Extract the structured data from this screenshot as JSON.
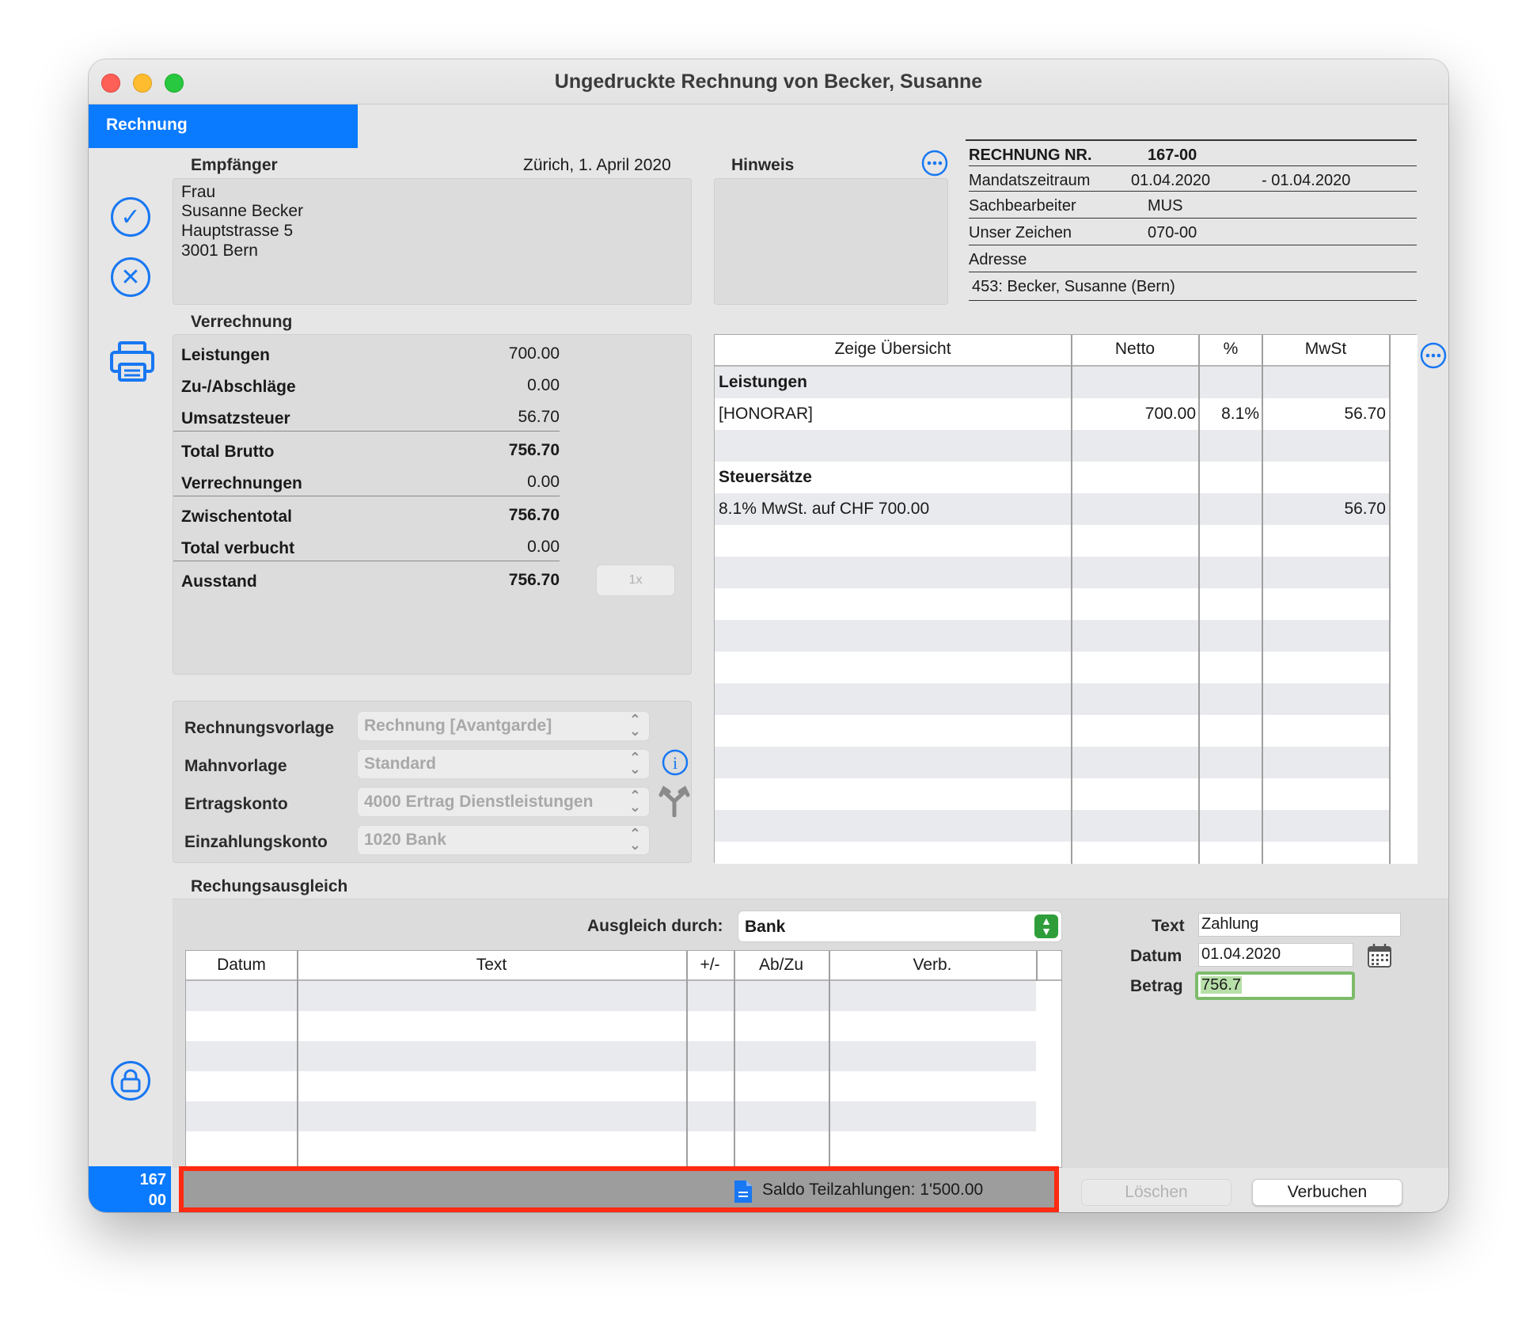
{
  "window": {
    "title": "Ungedruckte Rechnung von Becker, Susanne"
  },
  "tab": {
    "label": "Rechnung"
  },
  "recipient": {
    "heading": "Empfänger",
    "place_date": "Zürich, 1. April 2020",
    "lines": [
      "Frau",
      "Susanne Becker",
      "Hauptstrasse 5",
      "3001 Bern"
    ]
  },
  "note": {
    "heading": "Hinweis"
  },
  "invoice_info": {
    "number_label": "RECHNUNG NR.",
    "number_value": "167-00",
    "period_label": "Mandatszeitraum",
    "period_from": "01.04.2020",
    "period_to": "- 01.04.2020",
    "clerk_label": "Sachbearbeiter",
    "clerk_value": "MUS",
    "ref_label": "Unser Zeichen",
    "ref_value": "070-00",
    "address_label": "Adresse",
    "address_value": "453: Becker, Susanne (Bern)"
  },
  "billing": {
    "heading": "Verrechnung",
    "rows": [
      {
        "label": "Leistungen",
        "value": "700.00"
      },
      {
        "label": "Zu-/Abschläge",
        "value": "0.00"
      },
      {
        "label": "Umsatzsteuer",
        "value": "56.70"
      },
      {
        "label": "Total Brutto",
        "value": "756.70"
      },
      {
        "label": "Verrechnungen",
        "value": "0.00"
      },
      {
        "label": "Zwischentotal",
        "value": "756.70"
      },
      {
        "label": "Total verbucht",
        "value": "0.00"
      },
      {
        "label": "Ausstand",
        "value": "756.70"
      }
    ],
    "multiplier_button": "1x"
  },
  "overview": {
    "columns": [
      "Zeige Übersicht",
      "Netto",
      "%",
      "MwSt"
    ],
    "rows": [
      {
        "desc": "Leistungen",
        "netto": "",
        "pct": "",
        "mwst": ""
      },
      {
        "desc": "[HONORAR]",
        "netto": "700.00",
        "pct": "8.1%",
        "mwst": "56.70"
      },
      {
        "desc": "",
        "netto": "",
        "pct": "",
        "mwst": ""
      },
      {
        "desc": "Steuersätze",
        "netto": "",
        "pct": "",
        "mwst": ""
      },
      {
        "desc": "8.1% MwSt. auf CHF 700.00",
        "netto": "",
        "pct": "",
        "mwst": "56.70"
      }
    ]
  },
  "templates": {
    "invoice_template_label": "Rechnungsvorlage",
    "invoice_template_value": "Rechnung [Avantgarde]",
    "reminder_label": "Mahnvorlage",
    "reminder_value": "Standard",
    "revenue_label": "Ertragskonto",
    "revenue_value": "4000 Ertrag Dienstleistungen",
    "deposit_label": "Einzahlungskonto",
    "deposit_value": "1020 Bank"
  },
  "settlement": {
    "heading": "Rechungsausgleich",
    "method_label": "Ausgleich durch:",
    "method_value": "Bank",
    "columns": [
      "Datum",
      "Text",
      "+/-",
      "Ab/Zu",
      "Verb."
    ],
    "text_label": "Text",
    "text_value": "Zahlung",
    "date_label": "Datum",
    "date_value": "01.04.2020",
    "amount_label": "Betrag",
    "amount_value": "756.7",
    "delete_button": "Löschen",
    "book_button": "Verbuchen"
  },
  "status": {
    "number_top": "167",
    "number_bottom": "00",
    "message": "Saldo Teilzahlungen: 1'500.00"
  },
  "colors": {
    "accent": "#0a7aff",
    "highlight_border": "#ff2a12",
    "amount_field_border": "#7dbb6a"
  }
}
